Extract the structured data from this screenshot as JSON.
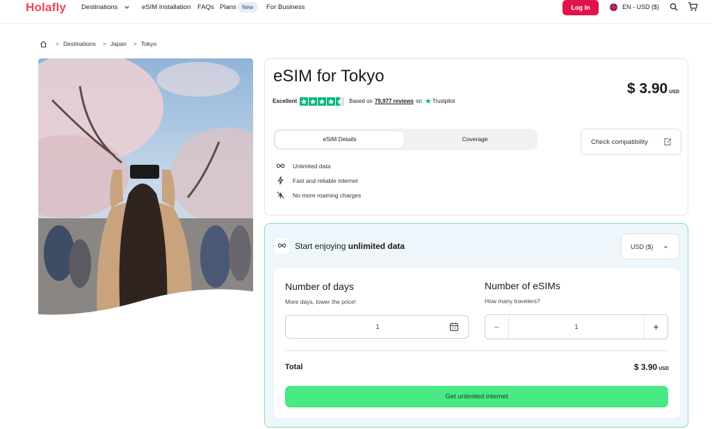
{
  "header": {
    "logo": "Holafly",
    "nav": {
      "destinations": "Destinations",
      "esim_installation": "eSIM Installation",
      "faqs": "FAQs",
      "plans": "Plans",
      "new_badge": "New",
      "for_business": "For Business"
    },
    "login": "Log In",
    "language": "EN - USD ($)",
    "icons": [
      "chevron-down-icon",
      "flag-uk-icon",
      "search-icon",
      "cart-icon"
    ]
  },
  "breadcrumb": {
    "items": [
      "Destinations",
      "Japan",
      "Tokyo"
    ],
    "separator": ">"
  },
  "product": {
    "title": "eSIM for Tokyo",
    "rating": {
      "word": "Excellent",
      "stars": 4.5,
      "based_on": "Based on",
      "reviews": "79,977 reviews",
      "on": "on",
      "provider": "Trustpilot"
    },
    "price": "$ 3.90",
    "price_currency": "USD",
    "tabs": [
      "eSIM Details",
      "Coverage"
    ],
    "active_tab": 0,
    "check_compatibility": "Check compatibility",
    "features": [
      "Unlimited data",
      "Fast and reliable internet",
      "No more roaming charges"
    ]
  },
  "purchase": {
    "heading_prefix": "Start enjoying",
    "heading_bold": "unlimited data",
    "currency_select": "USD ($)",
    "days": {
      "title": "Number of days",
      "subtitle": "More days, lower the price!",
      "value": "1"
    },
    "esims": {
      "title": "Number of eSIMs",
      "subtitle": "How many travelers?",
      "value": "1",
      "minus": "−",
      "plus": "+"
    },
    "total_label": "Total",
    "total_value": "$ 3.90",
    "total_currency": "USD",
    "cta": "Get unlimited internet"
  },
  "colors": {
    "brand": "#e8465d",
    "login_bg": "#e0144c",
    "trustpilot_green": "#00b67a",
    "cta_green": "#48e885",
    "purchase_border": "#7ee3a6",
    "purchase_bg": "#eef6fb"
  }
}
